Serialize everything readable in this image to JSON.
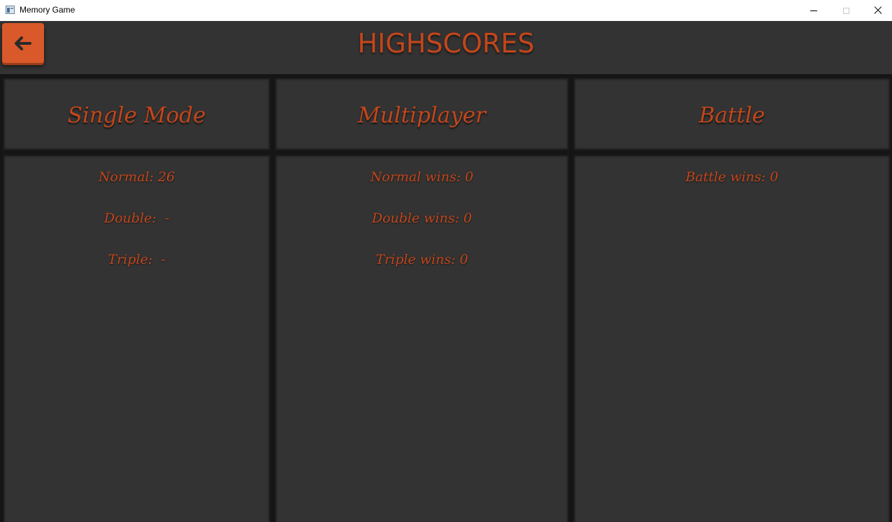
{
  "window": {
    "title": "Memory Game",
    "icons": {
      "app": "app-window-icon",
      "minimize": "minimize-icon",
      "maximize": "maximize-icon",
      "close": "close-icon"
    }
  },
  "header": {
    "title": "HIGHSCORES",
    "back_icon": "arrow-left-icon"
  },
  "colors": {
    "accent": "#c2461b",
    "button": "#d9592a",
    "panel": "#333333",
    "background": "#151515"
  },
  "columns": [
    {
      "title": "Single Mode",
      "stats": [
        "Normal: 26",
        "Double:  -",
        "Triple:  -"
      ]
    },
    {
      "title": "Multiplayer",
      "stats": [
        "Normal wins: 0",
        "Double wins: 0",
        "Triple wins: 0"
      ]
    },
    {
      "title": "Battle",
      "stats": [
        "Battle wins: 0"
      ]
    }
  ]
}
